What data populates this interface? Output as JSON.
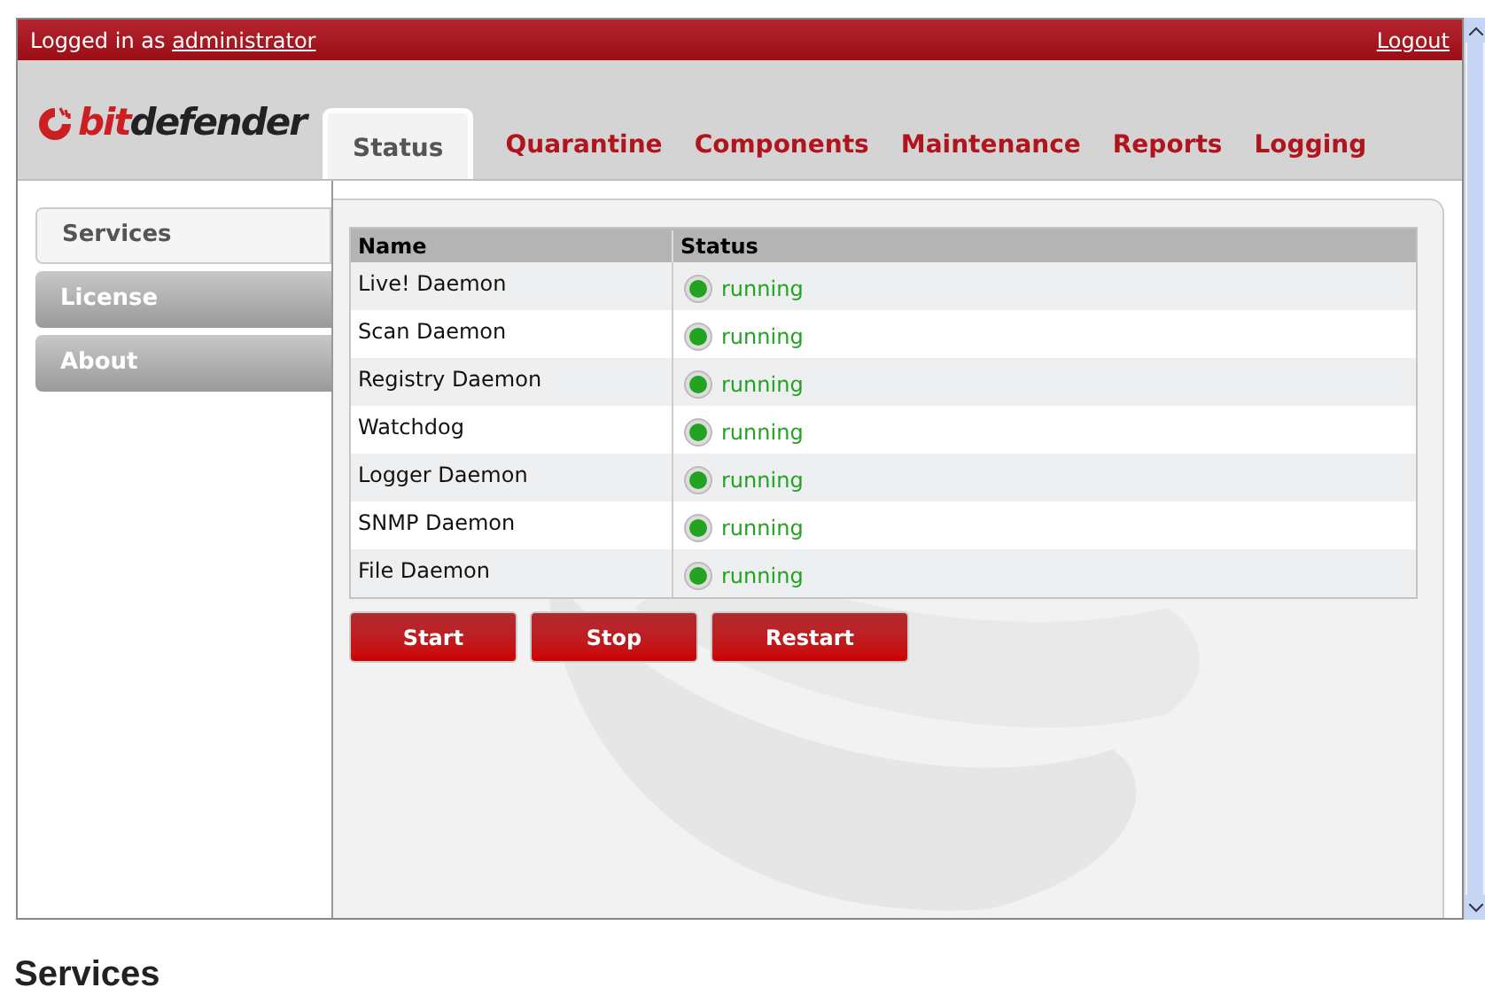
{
  "top_bar": {
    "prefix": "Logged in as",
    "user": "administrator",
    "logout": "Logout"
  },
  "logo": {
    "first": "bit",
    "rest": "defender"
  },
  "tabs": [
    {
      "label": "Status",
      "selected": true
    },
    {
      "label": "Quarantine",
      "selected": false
    },
    {
      "label": "Components",
      "selected": false
    },
    {
      "label": "Maintenance",
      "selected": false
    },
    {
      "label": "Reports",
      "selected": false
    },
    {
      "label": "Logging",
      "selected": false
    }
  ],
  "sidebar": {
    "items": [
      {
        "label": "Services",
        "selected": true
      },
      {
        "label": "License",
        "selected": false
      },
      {
        "label": "About",
        "selected": false
      }
    ]
  },
  "table": {
    "columns": [
      "Name",
      "Status"
    ],
    "rows": [
      {
        "name": "Live! Daemon",
        "status": "running",
        "color": "#22a322"
      },
      {
        "name": "Scan Daemon",
        "status": "running",
        "color": "#22a322"
      },
      {
        "name": "Registry Daemon",
        "status": "running",
        "color": "#22a322"
      },
      {
        "name": "Watchdog",
        "status": "running",
        "color": "#22a322"
      },
      {
        "name": "Logger Daemon",
        "status": "running",
        "color": "#22a322"
      },
      {
        "name": "SNMP Daemon",
        "status": "running",
        "color": "#22a322"
      },
      {
        "name": "File Daemon",
        "status": "running",
        "color": "#22a322"
      }
    ]
  },
  "buttons": [
    "Start",
    "Stop",
    "Restart"
  ],
  "caption": "Services"
}
